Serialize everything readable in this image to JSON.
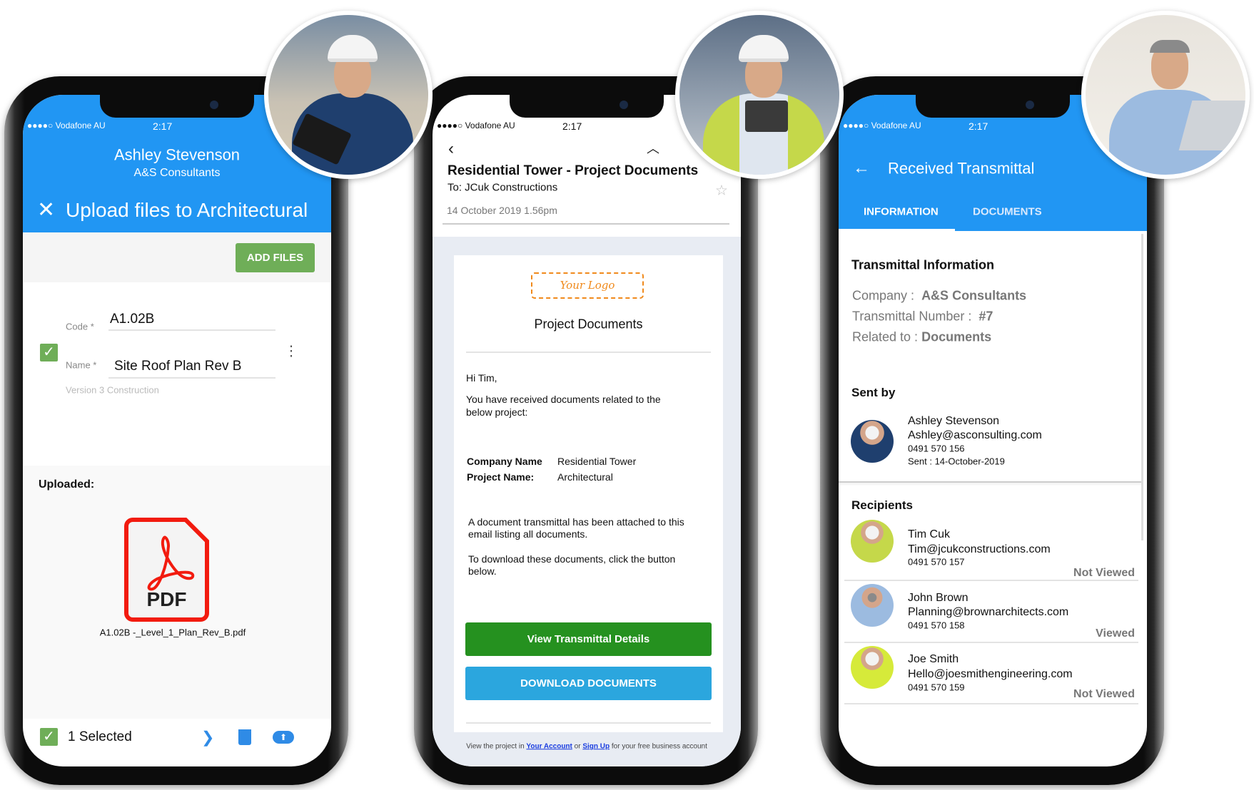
{
  "colors": {
    "primary_blue": "#2196f3",
    "add_files_green": "#6fae58",
    "view_button_green": "#25911f",
    "download_blue": "#2ba6de",
    "pdf_red": "#f21b0f",
    "link_blue": "#1a3de0"
  },
  "status_bar": {
    "carrier": "●●●●○ Vodafone AU",
    "time": "2:17",
    "wifi_icon": "wifi-icon"
  },
  "upload_screen": {
    "user_name": "Ashley Stevenson",
    "company": "A&S Consultants",
    "title": "Upload files to Architectural",
    "add_files_label": "ADD FILES",
    "code_label": "Code *",
    "code_value": "A1.02B",
    "name_label": "Name *",
    "name_value": "Site Roof Plan Rev B",
    "version": "Version 3 Construction",
    "uploaded_label": "Uploaded:",
    "pdf_label": "PDF",
    "file_name": "A1.02B -_Level_1_Plan_Rev_B.pdf",
    "selected_count": "1 Selected"
  },
  "email_screen": {
    "subject": "Residential Tower - Project Documents",
    "to": "To: JCuk Constructions",
    "date": "14 October 2019 1.56pm",
    "logo_text": "Your Logo",
    "heading": "Project Documents",
    "greeting": "Hi Tim,",
    "intro_1": "You have received documents related to the",
    "intro_2": "below project:",
    "company_label": "Company Name",
    "company_value": "Residential Tower",
    "project_label": "Project Name:",
    "project_value": "Architectural",
    "para1_1": "A document transmittal has been attached to this",
    "para1_2": "email listing all documents.",
    "para2_1": "To download these documents, click the button",
    "para2_2": "below.",
    "view_button": "View Transmittal Details",
    "download_button": "DOWNLOAD DOCUMENTS",
    "footer_pre": "View the project in",
    "footer_link1": "Your Account",
    "footer_mid": "or",
    "footer_link2": "Sign Up",
    "footer_post": "for your free business account"
  },
  "transmittal_screen": {
    "title": "Received Transmittal",
    "tabs": [
      {
        "label": "INFORMATION",
        "active": true
      },
      {
        "label": "DOCUMENTS",
        "active": false
      }
    ],
    "info_heading": "Transmittal Information",
    "company_label": "Company :",
    "company_value": "A&S Consultants",
    "number_label": "Transmittal Number :",
    "number_value": "#7",
    "related_label": "Related to :",
    "related_value": "Documents",
    "sent_by_heading": "Sent by",
    "sender": {
      "name": "Ashley Stevenson",
      "email": "Ashley@asconsulting.com",
      "phone": "0491 570 156",
      "sent": "Sent : 14-October-2019"
    },
    "recipients_heading": "Recipients",
    "recipients": [
      {
        "name": "Tim Cuk",
        "email": "Tim@jcukconstructions.com",
        "phone": "0491 570 157",
        "status": "Not Viewed"
      },
      {
        "name": "John Brown",
        "email": "Planning@brownarchitects.com",
        "phone": "0491 570 158",
        "status": "Viewed"
      },
      {
        "name": "Joe Smith",
        "email": "Hello@joesmithengineering.com",
        "phone": "0491 570 159",
        "status": "Not Viewed"
      }
    ]
  }
}
